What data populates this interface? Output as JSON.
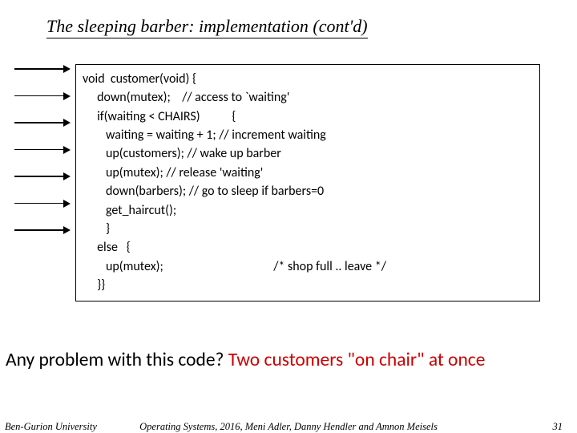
{
  "title": "The sleeping barber: implementation (cont'd)",
  "arrow_count": 7,
  "code": {
    "l0": "void  customer(void) {",
    "l1": "     down(mutex);    // access to `waiting'",
    "l2": "     if(waiting < CHAIRS)           {",
    "l3": "        waiting = waiting + 1; // increment waiting",
    "l4": "        up(customers); // wake up barber",
    "l5": "        up(mutex); // release 'waiting'",
    "l6": "        down(barbers); // go to sleep if barbers=0",
    "l7": "        get_haircut();",
    "l8": "        }",
    "l9": "     else   {",
    "l10": "        up(mutex);                                      /* shop full .. leave */",
    "l11": "     }}"
  },
  "question_prefix": "Any problem with this code?  ",
  "question_answer": "Two customers \"on chair\" at once",
  "footer": {
    "left": "Ben-Gurion University",
    "center": "Operating Systems, 2016, Meni Adler, Danny Hendler and Amnon Meisels",
    "page": "31"
  }
}
